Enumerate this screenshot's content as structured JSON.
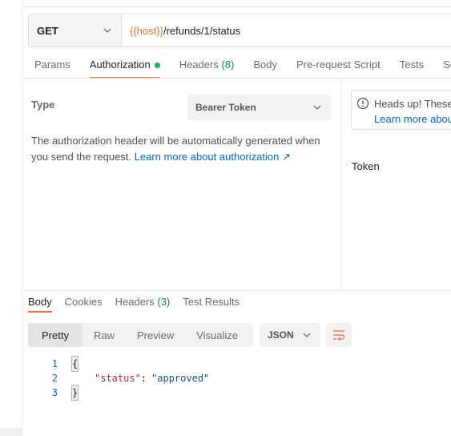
{
  "request": {
    "method": "GET",
    "url_var": "{{host}}",
    "url_path": "/refunds/1/status"
  },
  "tabs": [
    {
      "label": "Params"
    },
    {
      "label": "Authorization"
    },
    {
      "label": "Headers",
      "count": "(8)"
    },
    {
      "label": "Body"
    },
    {
      "label": "Pre-request Script"
    },
    {
      "label": "Tests"
    },
    {
      "label": "Se"
    }
  ],
  "auth": {
    "type_label": "Type",
    "type_value": "Bearer Token",
    "description": "The authorization header will be automatically generated when you send the request. ",
    "learn_link": "Learn more about authorization ↗",
    "notice_title": "Heads up! These",
    "notice_link": "Learn more about",
    "token_label": "Token"
  },
  "response": {
    "tabs": [
      {
        "label": "Body"
      },
      {
        "label": "Cookies"
      },
      {
        "label": "Headers",
        "count": "(3)"
      },
      {
        "label": "Test Results"
      }
    ],
    "views": [
      "Pretty",
      "Raw",
      "Preview",
      "Visualize"
    ],
    "format": "JSON",
    "code": {
      "line_numbers": [
        "1",
        "2",
        "3"
      ],
      "open_brace": "{",
      "key": "\"status\"",
      "colon": ":",
      "value": "\"approved\"",
      "close_brace": "}"
    }
  },
  "colors": {
    "accent": "#ff6c37",
    "variable": "#e8723a",
    "link": "#0265d2",
    "success_dot": "#0cbb52"
  },
  "icons": {
    "method_dropdown": "chevron-down-icon",
    "auth_type_dropdown": "chevron-down-icon",
    "notice": "info-icon",
    "format_dropdown": "chevron-down-icon",
    "wrap": "wrap-lines-icon"
  }
}
